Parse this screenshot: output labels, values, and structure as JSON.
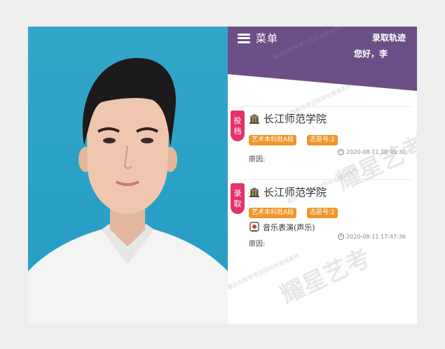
{
  "header": {
    "menu_label": "菜单",
    "track_link": "录取轨迹",
    "greeting": "您好，李",
    "bg_color": "#6c4f86"
  },
  "watermark": {
    "small_text": "重庆市教育考试院综合查询系统",
    "large_text": "耀星艺考"
  },
  "records": [
    {
      "status_tag": [
        "投",
        "档"
      ],
      "school": "长江师范学院",
      "pills": [
        "艺术本科批A段",
        "志愿号:2"
      ],
      "timestamp": "2020-08-11 10:49:30",
      "major": "",
      "reason_label": "原因:"
    },
    {
      "status_tag": [
        "录",
        "取"
      ],
      "school": "长江师范学院",
      "pills": [
        "艺术本科批A段",
        "志愿号:2"
      ],
      "timestamp": "2020-08-11 17:47:36",
      "major": "音乐表演(声乐)",
      "reason_label": "原因:"
    }
  ],
  "colors": {
    "accent_pink": "#e2336b",
    "pill_orange": "#f0962c",
    "photo_bg": "#2aa0c6"
  }
}
